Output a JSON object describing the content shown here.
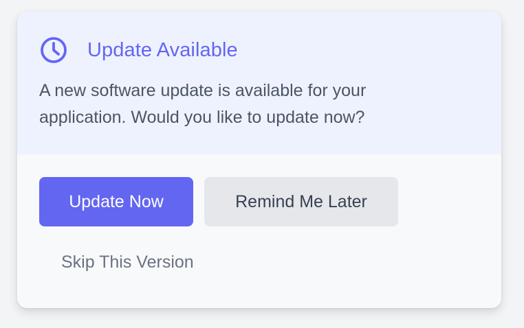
{
  "dialog": {
    "title": "Update Available",
    "message": "A new software update is available for your application. Would you like to update now?",
    "icon": "clock-icon"
  },
  "actions": {
    "update_now_label": "Update Now",
    "remind_later_label": "Remind Me Later",
    "skip_label": "Skip This Version"
  },
  "colors": {
    "accent": "#6366f1",
    "header_bg": "#eef2ff",
    "secondary_button_bg": "#e5e7eb",
    "text_body": "#4b5563",
    "text_muted": "#6b7280"
  }
}
